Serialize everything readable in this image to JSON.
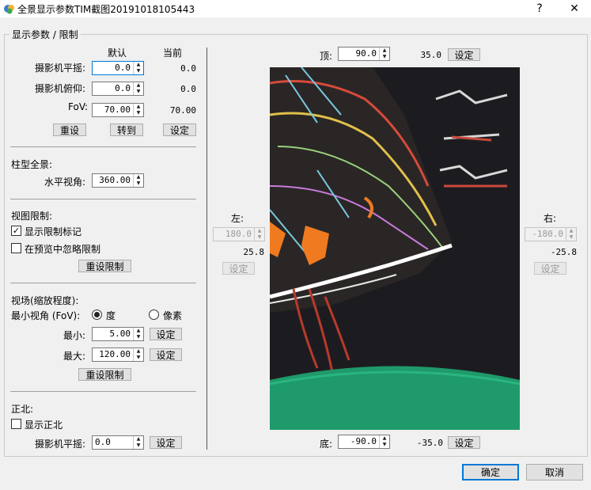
{
  "window": {
    "title": "全景显示参数TIM截图20191018105443",
    "help_symbol": "?",
    "close_symbol": "✕"
  },
  "group_title": "显示参数 / 限制",
  "camera": {
    "header_default": "默认",
    "header_current": "当前",
    "pan_label": "摄影机平摇:",
    "pan_value": "0.0",
    "pan_current": "0.0",
    "tilt_label": "摄影机俯仰:",
    "tilt_value": "0.0",
    "tilt_current": "0.0",
    "fov_label": "FoV:",
    "fov_value": "70.00",
    "fov_current": "70.00",
    "reset_button": "重设",
    "goto_button": "转到",
    "set_button": "设定"
  },
  "cylinder": {
    "heading": "柱型全景:",
    "hfov_label": "水平视角:",
    "hfov_value": "360.00"
  },
  "view_limits": {
    "heading": "视图限制:",
    "show_markers_label": "显示限制标记",
    "show_markers_checked": "✓",
    "ignore_preview_label": "在预览中忽略限制",
    "reset_button": "重设限制"
  },
  "zoom": {
    "heading": "视场(缩放程度):",
    "min_fov_label": "最小视角 (FoV):",
    "unit_degree": "度",
    "unit_pixel": "像素",
    "min_label": "最小:",
    "min_value": "5.00",
    "max_label": "最大:",
    "max_value": "120.00",
    "set_button": "设定",
    "reset_button": "重设限制"
  },
  "north": {
    "heading": "正北:",
    "show_label": "显示正北",
    "pan_label": "摄影机平摇:",
    "pan_value": "0.0",
    "set_button": "设定"
  },
  "limits": {
    "top_label": "顶:",
    "top_value": "90.0",
    "top_current": "35.0",
    "bottom_label": "底:",
    "bottom_value": "-90.0",
    "bottom_current": "-35.0",
    "left_label": "左:",
    "left_value": "180.0",
    "left_current": "25.8",
    "right_label": "右:",
    "right_value": "-180.0",
    "right_current": "-25.8",
    "set_button": "设定"
  },
  "dialog": {
    "ok_button": "确定",
    "cancel_button": "取消"
  },
  "colors": {
    "accent": "#0078d7",
    "preview_bg": "#1c1c20",
    "preview_green": "#1f9a6a"
  }
}
